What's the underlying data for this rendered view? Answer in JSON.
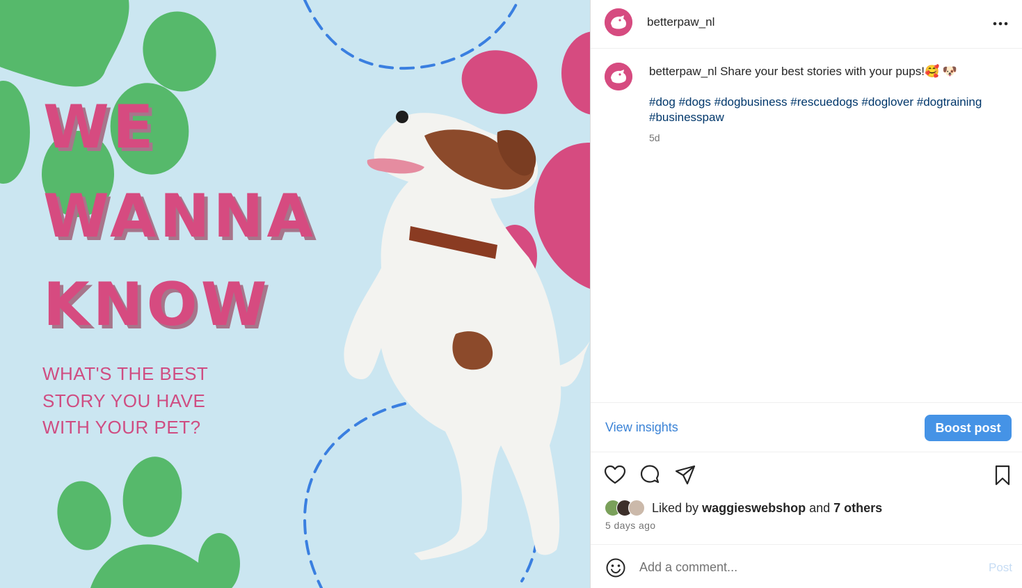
{
  "image": {
    "headline": [
      "WE",
      "WANNA",
      "KNOW"
    ],
    "subline": [
      "WHAT'S THE BEST",
      "STORY YOU HAVE",
      "WITH YOUR PET?"
    ],
    "colors": {
      "background": "#cbe6f1",
      "pink": "#d64b80",
      "green": "#56b96b",
      "dashes": "#3a7fe0"
    }
  },
  "header": {
    "username": "betterpaw_nl",
    "more_icon": "more-horizontal-icon"
  },
  "caption": {
    "username": "betterpaw_nl",
    "text": "Share your best stories with your pups!",
    "emojis": "🥰 🐶",
    "hashtags": [
      "#dog",
      "#dogs",
      "#dogbusiness",
      "#rescuedogs",
      "#doglover",
      "#dogtraining",
      "#businesspaw"
    ],
    "time": "5d"
  },
  "insights": {
    "view_label": "View insights",
    "boost_label": "Boost post"
  },
  "actions": {
    "icons": [
      "heart-icon",
      "comment-icon",
      "share-icon",
      "bookmark-icon"
    ]
  },
  "likes": {
    "prefix": "Liked by",
    "user": "waggieswebshop",
    "and": "and",
    "others": "7 others",
    "time_ago": "5 days ago"
  },
  "comment": {
    "placeholder": "Add a comment...",
    "post_label": "Post",
    "emoji_icon": "emoji-icon"
  }
}
